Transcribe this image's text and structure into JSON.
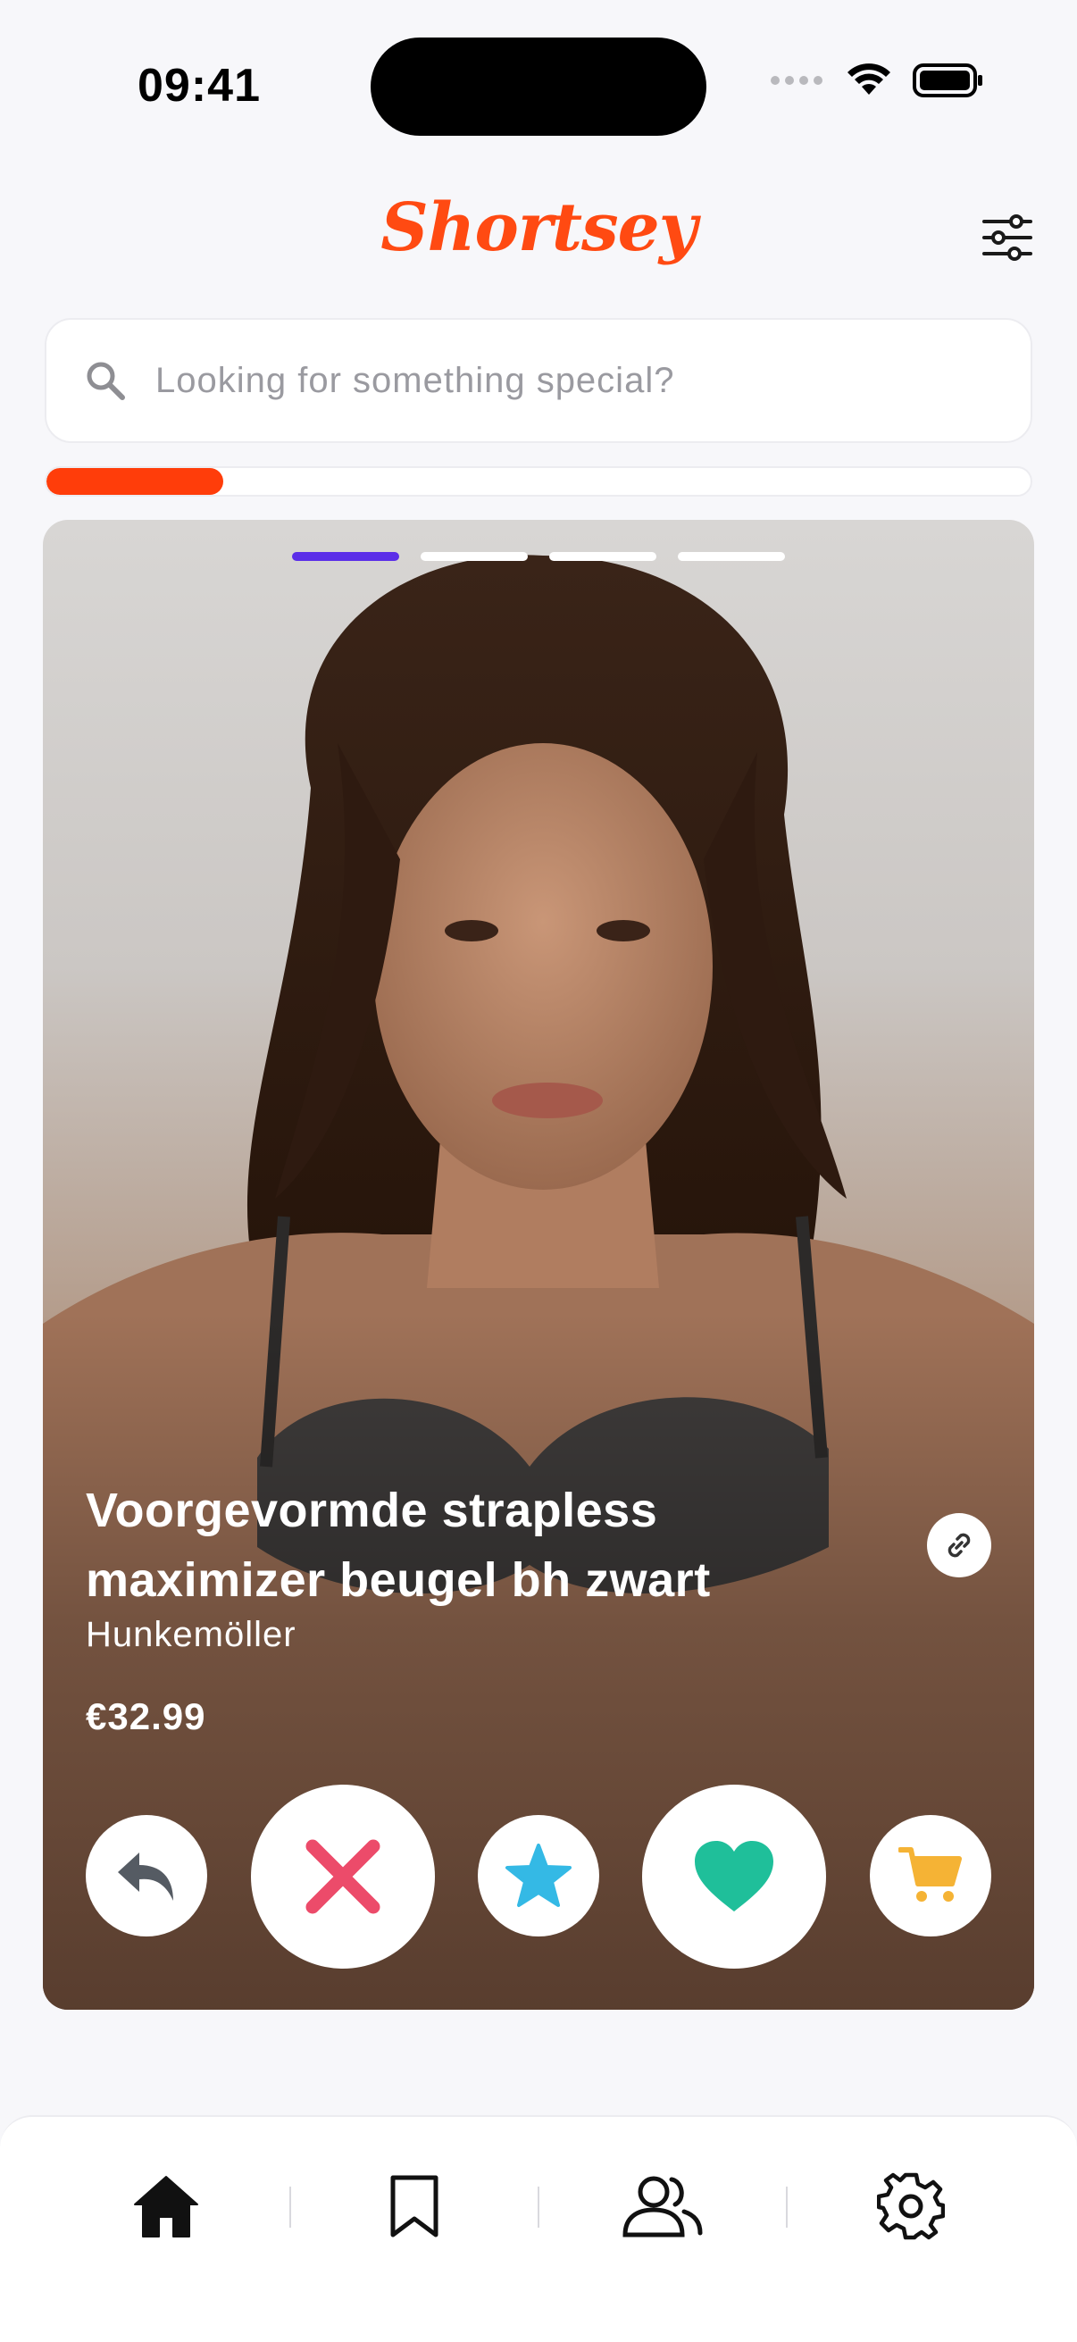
{
  "status_bar": {
    "time": "09:41"
  },
  "header": {
    "logo": "Shortsey"
  },
  "search": {
    "placeholder": "Looking for something special?"
  },
  "progress": {
    "fraction": 0.18
  },
  "card": {
    "image_count": 4,
    "active_image": 1,
    "title_line1": "Voorgevormde strapless",
    "title_line2": "maximizer beugel bh zwart",
    "brand": "Hunkemöller",
    "price": "€32.99"
  },
  "actions": [
    {
      "name": "undo",
      "icon": "undo-arrow-icon",
      "color": "#555b63"
    },
    {
      "name": "dislike",
      "icon": "x-icon",
      "color": "#ec4b6a"
    },
    {
      "name": "superlike",
      "icon": "star-icon",
      "color": "#34b9e5"
    },
    {
      "name": "like",
      "icon": "heart-icon",
      "color": "#1fbf9a"
    },
    {
      "name": "cart",
      "icon": "cart-icon",
      "color": "#f5b335"
    }
  ],
  "nav": [
    {
      "name": "home",
      "icon": "home-icon",
      "active": true
    },
    {
      "name": "saved",
      "icon": "bookmark-icon",
      "active": false
    },
    {
      "name": "friends",
      "icon": "users-icon",
      "active": false
    },
    {
      "name": "settings",
      "icon": "gear-icon",
      "active": false
    }
  ],
  "colors": {
    "brand": "#ff4a12",
    "progress": "#ff3d0a",
    "active_dot": "#5b2ee8"
  }
}
